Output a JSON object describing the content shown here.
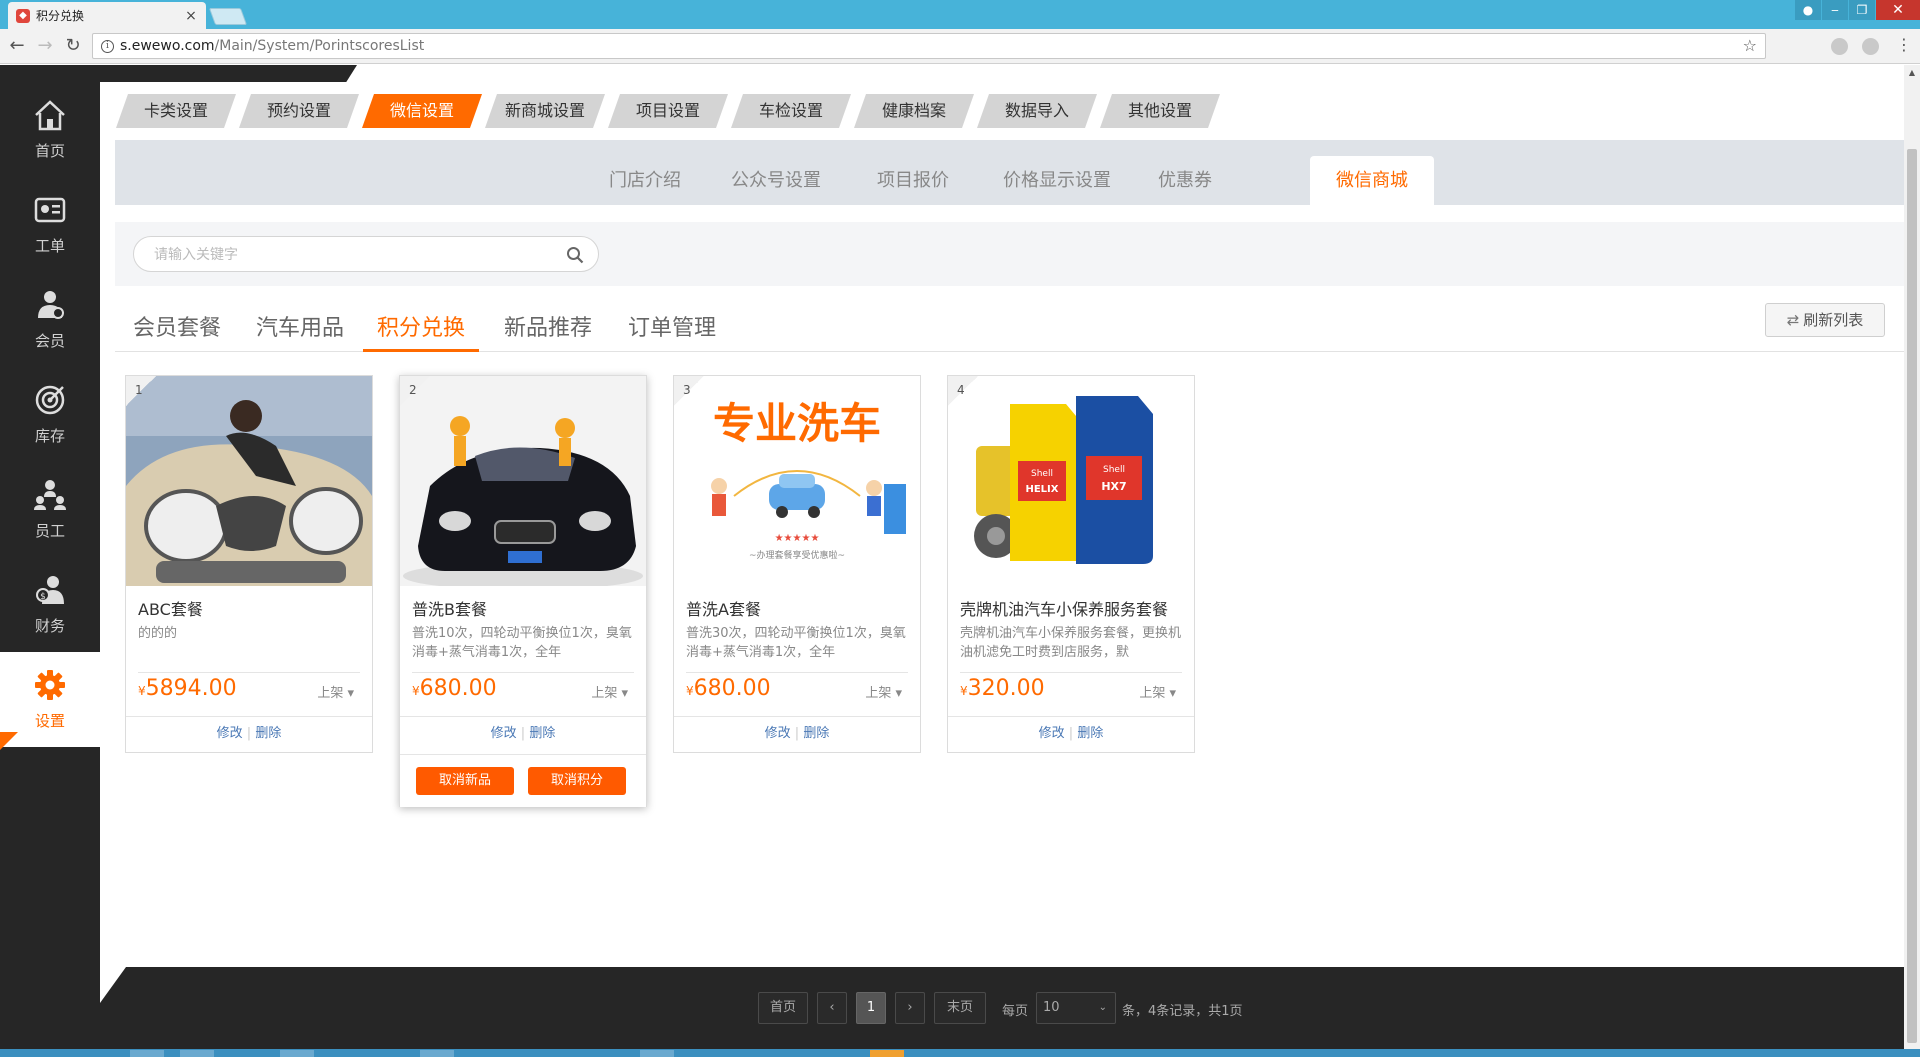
{
  "browser": {
    "tab_title": "积分兑换",
    "tab_close": "×",
    "url_host": "s.ewewo.com",
    "url_path": "/Main/System/PorintscoresList",
    "info_glyph": "i"
  },
  "sidebar": {
    "items": [
      {
        "label": "首页",
        "icon": "home-icon"
      },
      {
        "label": "工单",
        "icon": "work-order-icon"
      },
      {
        "label": "会员",
        "icon": "member-icon"
      },
      {
        "label": "库存",
        "icon": "inventory-icon"
      },
      {
        "label": "员工",
        "icon": "staff-icon"
      },
      {
        "label": "财务",
        "icon": "finance-icon"
      },
      {
        "label": "设置",
        "icon": "gear-icon",
        "active": true
      }
    ]
  },
  "top_tabs": [
    "卡类设置",
    "预约设置",
    "微信设置",
    "新商城设置",
    "项目设置",
    "车检设置",
    "健康档案",
    "数据导入",
    "其他设置"
  ],
  "top_tab_active": "微信设置",
  "sub_tabs": [
    "门店介绍",
    "公众号设置",
    "项目报价",
    "价格显示设置",
    "优惠券",
    "微信商城"
  ],
  "sub_tab_active": "微信商城",
  "search": {
    "placeholder": "请输入关键字"
  },
  "category_tabs": [
    "会员套餐",
    "汽车用品",
    "积分兑换",
    "新品推荐",
    "订单管理"
  ],
  "category_tab_active": "积分兑换",
  "refresh_label": "刷新列表",
  "products": [
    {
      "index": "1",
      "name": "ABC套餐",
      "desc": "的的的",
      "currency": "¥",
      "price": "5894.00",
      "status": "上架",
      "edit": "修改",
      "sep": "|",
      "delete": "删除"
    },
    {
      "index": "2",
      "name": "普洗B套餐",
      "desc": "普洗10次，四轮动平衡换位1次，臭氧消毒+蒸气消毒1次，全年",
      "currency": "¥",
      "price": "680.00",
      "status": "上架",
      "edit": "修改",
      "sep": "|",
      "delete": "删除",
      "btn_cancel_new": "取消新品",
      "btn_cancel_points": "取消积分"
    },
    {
      "index": "3",
      "name": "普洗A套餐",
      "desc": "普洗30次，四轮动平衡换位1次，臭氧消毒+蒸气消毒1次，全年",
      "currency": "¥",
      "price": "680.00",
      "status": "上架",
      "edit": "修改",
      "sep": "|",
      "delete": "删除",
      "image_text": "专业洗车",
      "image_caption": "~办理套餐享受优惠啦~"
    },
    {
      "index": "4",
      "name": "壳牌机油汽车小保养服务套餐",
      "desc": "壳牌机油汽车小保养服务套餐，更换机油机滤免工时费到店服务，默",
      "currency": "¥",
      "price": "320.00",
      "status": "上架",
      "edit": "修改",
      "sep": "|",
      "delete": "删除",
      "image_brand": "HELIX"
    }
  ],
  "pagination": {
    "first": "首页",
    "prev": "‹",
    "current": "1",
    "next": "›",
    "last": "末页",
    "per_page_label": "每页",
    "per_page_value": "10",
    "summary": "条，4条记录，共1页"
  },
  "colors": {
    "accent": "#ff6a00",
    "sidebar": "#262626",
    "browser_frame": "#47b3d9"
  }
}
